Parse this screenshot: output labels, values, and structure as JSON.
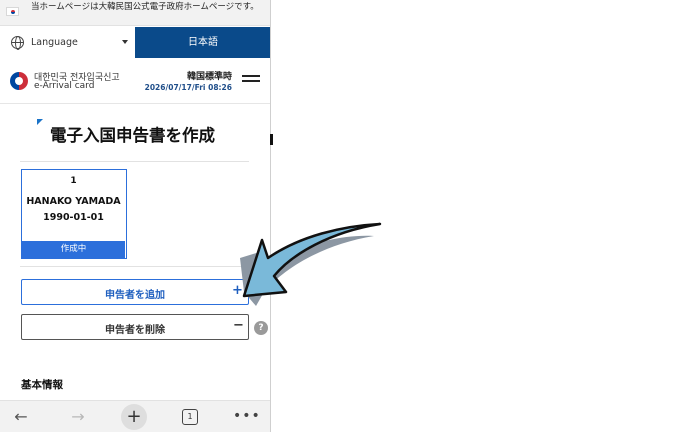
{
  "notice": {
    "text": "当ホームページは大韓民国公式電子政府ホームページです。"
  },
  "language": {
    "label": "Language",
    "selected": "日本語"
  },
  "header": {
    "brand_ko": "대한민국 전자입국신고",
    "brand_en": "e-Arrival card",
    "time_label": "韓国標準時",
    "time_value": "2026/07/17/Fri 08:26"
  },
  "page": {
    "title": "電子入国申告書を作成"
  },
  "applicant_card": {
    "number": "1",
    "name": "HANAKO YAMADA",
    "dob": "1990-01-01",
    "status": "作成中"
  },
  "actions": {
    "add_label": "申告者を追加",
    "add_symbol": "+",
    "remove_label": "申告者を削除",
    "remove_symbol": "−",
    "help_symbol": "?"
  },
  "section": {
    "basic_info": "基本情報"
  },
  "navbar": {
    "back": "←",
    "forward": "→",
    "new_tab": "+",
    "tab_count": "1",
    "more": "•••"
  },
  "colors": {
    "brand_blue": "#0a4a8a",
    "accent_blue": "#2c6fdb",
    "arrow_fill": "#7ab9d9",
    "arrow_shadow": "#8c97a3"
  },
  "annotation": {
    "icon": "pointing-arrow-icon"
  }
}
